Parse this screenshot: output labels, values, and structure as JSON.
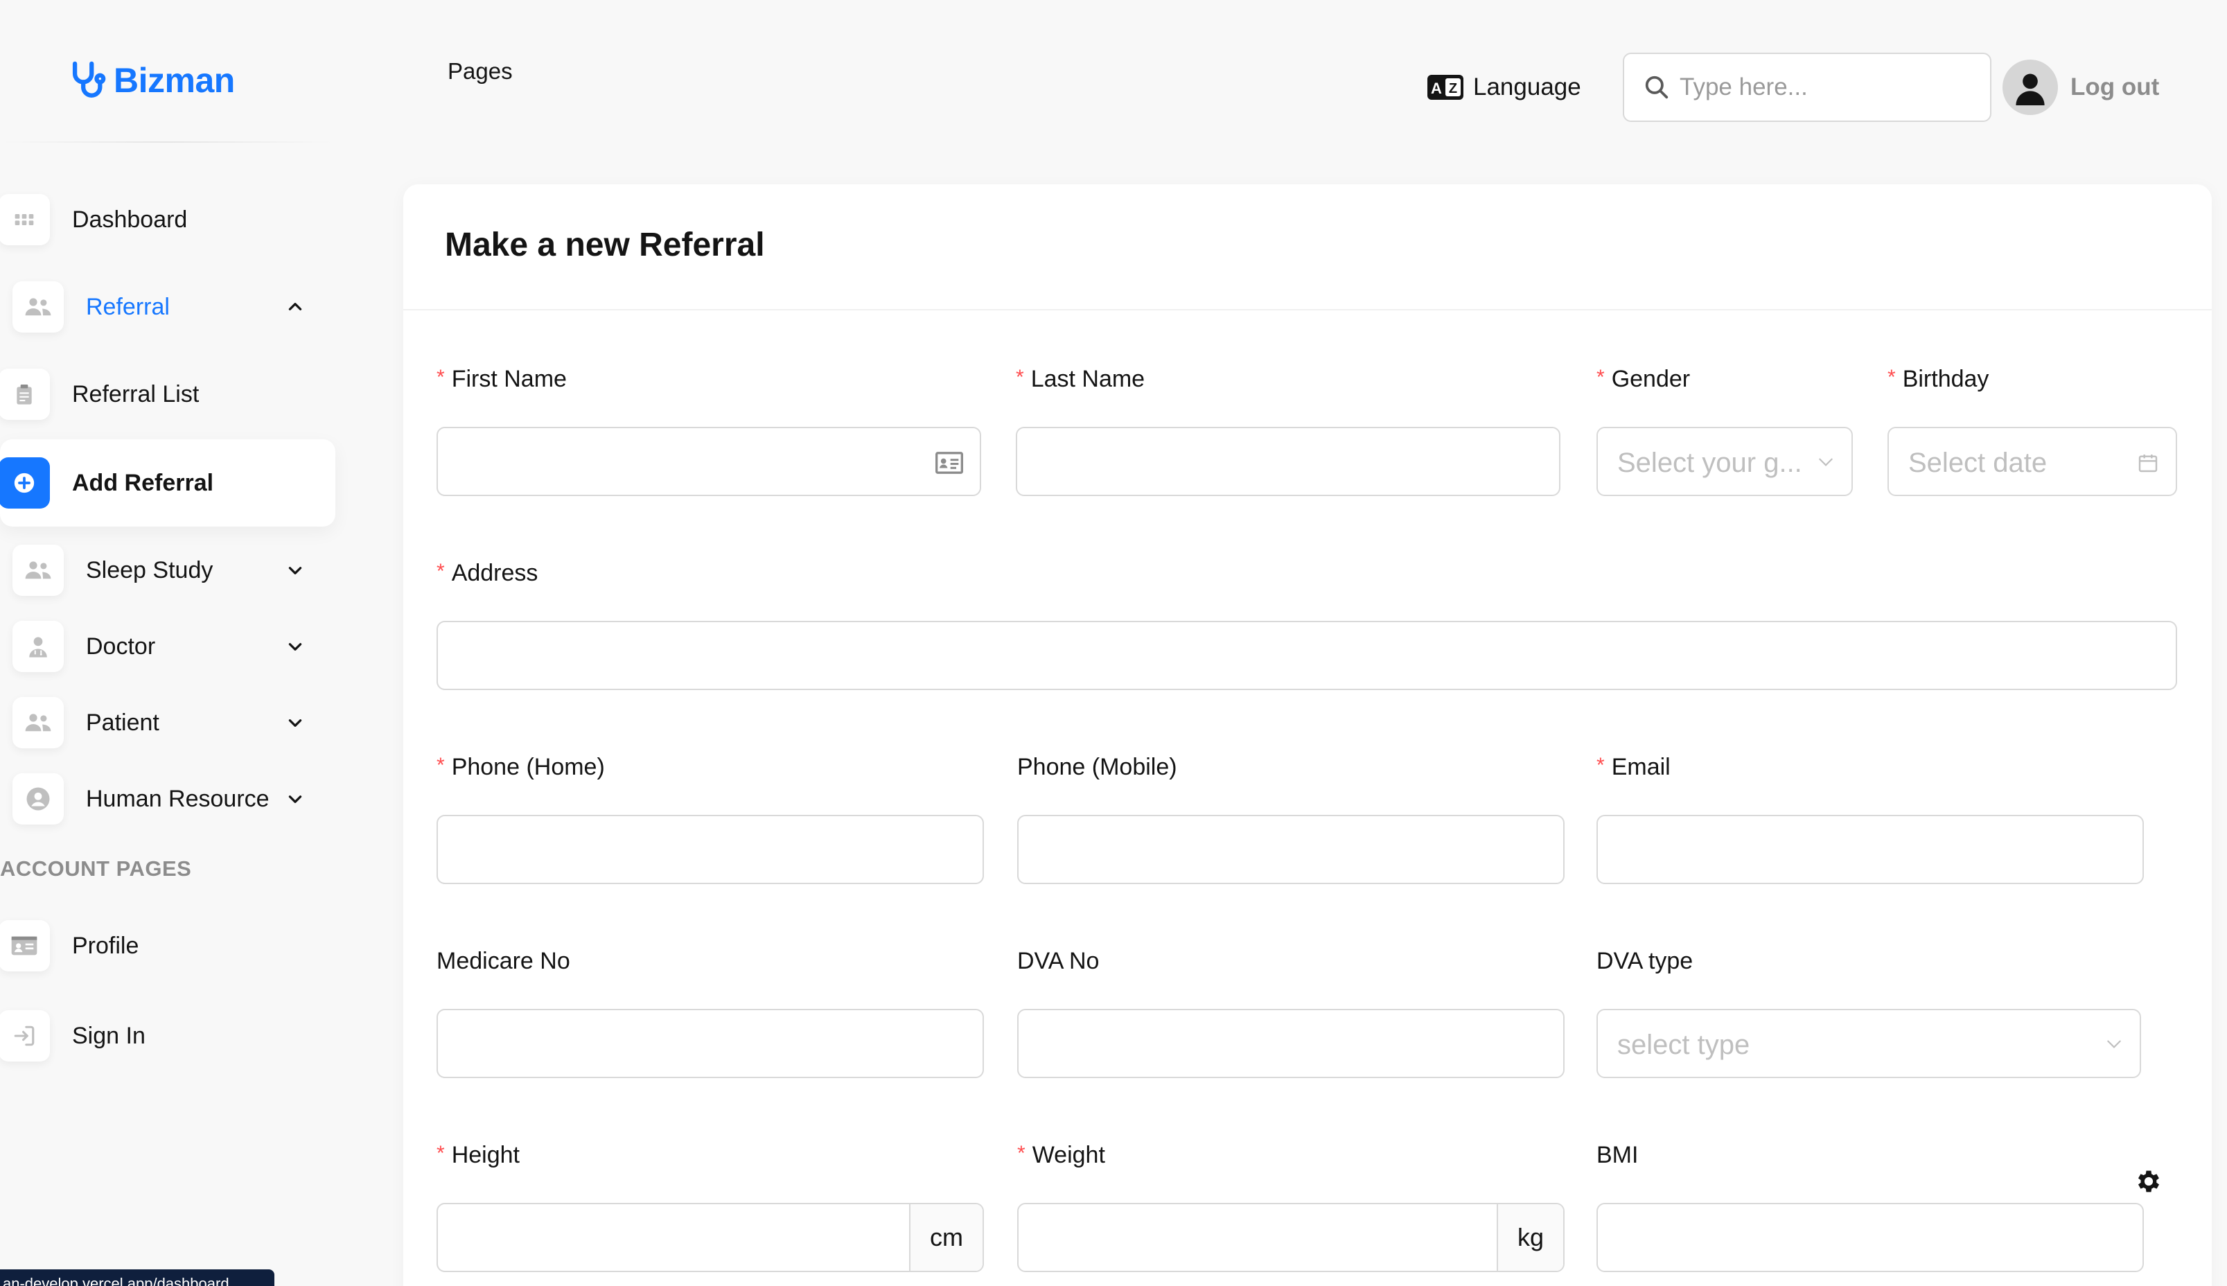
{
  "brand": {
    "name": "Bizman",
    "color": "#1677ff",
    "icon": "stethoscope-icon"
  },
  "breadcrumb": "Pages",
  "header": {
    "language_label": "Language",
    "search_placeholder": "Type here...",
    "logout_label": "Log out"
  },
  "sidebar": {
    "items": [
      {
        "label": "Dashboard",
        "icon": "grid-icon"
      },
      {
        "label": "Referral",
        "icon": "users-icon",
        "expanded": true
      },
      {
        "label": "Referral List",
        "icon": "clipboard-icon"
      },
      {
        "label": "Add Referral",
        "icon": "plus-circle-icon",
        "active": true
      },
      {
        "label": "Sleep Study",
        "icon": "users-icon"
      },
      {
        "label": "Doctor",
        "icon": "doctor-icon"
      },
      {
        "label": "Patient",
        "icon": "users-icon"
      },
      {
        "label": "Human Resource",
        "icon": "user-circle-icon"
      }
    ],
    "section_title": "ACCOUNT PAGES",
    "account_items": [
      {
        "label": "Profile",
        "icon": "id-card-icon"
      },
      {
        "label": "Sign In",
        "icon": "sign-in-icon"
      }
    ]
  },
  "form": {
    "title": "Make a new Referral",
    "required_mark": "*",
    "fields": {
      "first_name": {
        "label": "First Name",
        "required": true,
        "value": ""
      },
      "last_name": {
        "label": "Last Name",
        "required": true,
        "value": ""
      },
      "gender": {
        "label": "Gender",
        "required": true,
        "placeholder": "Select your g..."
      },
      "birthday": {
        "label": "Birthday",
        "required": true,
        "placeholder": "Select date"
      },
      "address": {
        "label": "Address",
        "required": true,
        "value": ""
      },
      "phone_home": {
        "label": "Phone (Home)",
        "required": true,
        "value": ""
      },
      "phone_mobile": {
        "label": "Phone (Mobile)",
        "required": false,
        "value": ""
      },
      "email": {
        "label": "Email",
        "required": true,
        "value": ""
      },
      "medicare_no": {
        "label": "Medicare No",
        "required": false,
        "value": ""
      },
      "dva_no": {
        "label": "DVA No",
        "required": false,
        "value": ""
      },
      "dva_type": {
        "label": "DVA type",
        "required": false,
        "placeholder": "select type"
      },
      "height": {
        "label": "Height",
        "required": true,
        "unit": "cm",
        "value": ""
      },
      "weight": {
        "label": "Weight",
        "required": true,
        "unit": "kg",
        "value": ""
      },
      "bmi": {
        "label": "BMI",
        "required": false,
        "value": ""
      }
    }
  },
  "status_url": "an-develop.vercel.app/dashboard"
}
